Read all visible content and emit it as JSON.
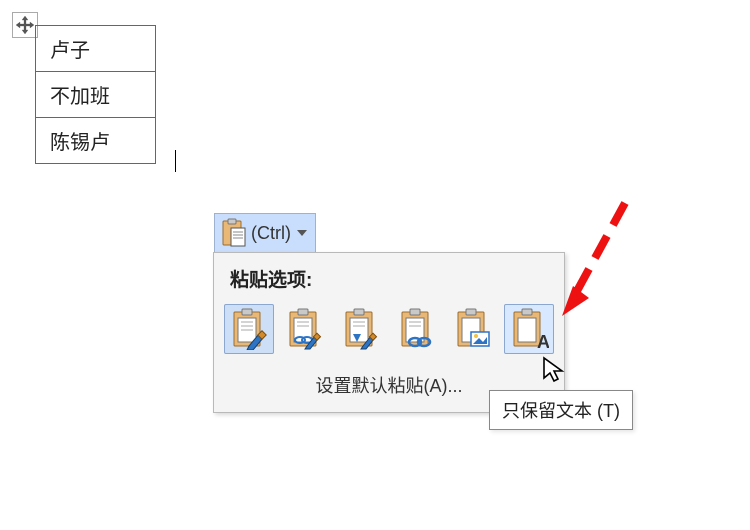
{
  "table": {
    "rows": [
      "卢子",
      "不加班",
      "陈锡卢"
    ]
  },
  "paste_button": {
    "label": "(Ctrl)"
  },
  "panel": {
    "title": "粘贴选项:",
    "options": [
      {
        "name": "keep-source-formatting",
        "overlay": "brush"
      },
      {
        "name": "merge-formatting",
        "overlay": "brush-link"
      },
      {
        "name": "use-destination-styles",
        "overlay": "brush-merge"
      },
      {
        "name": "link-and-keep-formatting",
        "overlay": "link"
      },
      {
        "name": "picture",
        "overlay": "picture"
      },
      {
        "name": "keep-text-only",
        "overlay": "A"
      }
    ],
    "default_label": "设置默认粘贴(A)..."
  },
  "tooltip": {
    "text": "只保留文本 (T)"
  }
}
